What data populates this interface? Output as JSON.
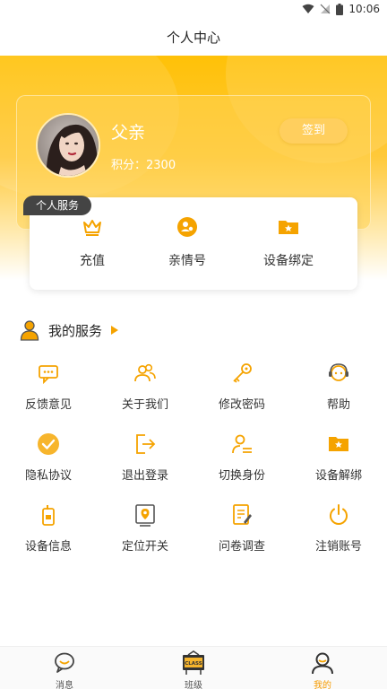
{
  "status_bar": {
    "time": "10:06"
  },
  "header": {
    "title": "个人中心"
  },
  "profile": {
    "name": "父亲",
    "points": "积分：2300",
    "sign_in_label": "签到"
  },
  "personal_services": {
    "tag": "个人服务",
    "items": [
      {
        "label": "充值",
        "icon": "crown-icon"
      },
      {
        "label": "亲情号",
        "icon": "family-number-icon"
      },
      {
        "label": "设备绑定",
        "icon": "folder-star-icon"
      }
    ]
  },
  "my_services": {
    "title": "我的服务",
    "items": [
      {
        "label": "反馈意见",
        "icon": "feedback-icon"
      },
      {
        "label": "关于我们",
        "icon": "users-icon"
      },
      {
        "label": "修改密码",
        "icon": "key-icon"
      },
      {
        "label": "帮助",
        "icon": "help-icon"
      },
      {
        "label": "隐私协议",
        "icon": "check-circle-icon"
      },
      {
        "label": "退出登录",
        "icon": "logout-icon"
      },
      {
        "label": "切换身份",
        "icon": "switch-user-icon"
      },
      {
        "label": "设备解绑",
        "icon": "folder-star-icon"
      },
      {
        "label": "设备信息",
        "icon": "device-icon"
      },
      {
        "label": "定位开关",
        "icon": "location-icon"
      },
      {
        "label": "问卷调查",
        "icon": "survey-icon"
      },
      {
        "label": "注销账号",
        "icon": "power-icon"
      }
    ]
  },
  "tabbar": {
    "tabs": [
      {
        "label": "消息",
        "icon": "message-icon"
      },
      {
        "label": "班级",
        "icon": "class-board-icon",
        "board_text": "CLASS"
      },
      {
        "label": "我的",
        "icon": "profile-icon"
      }
    ],
    "active_index": 2
  },
  "colors": {
    "accent": "#f5a300",
    "accent_light": "#ffc93a",
    "text": "#333333"
  }
}
